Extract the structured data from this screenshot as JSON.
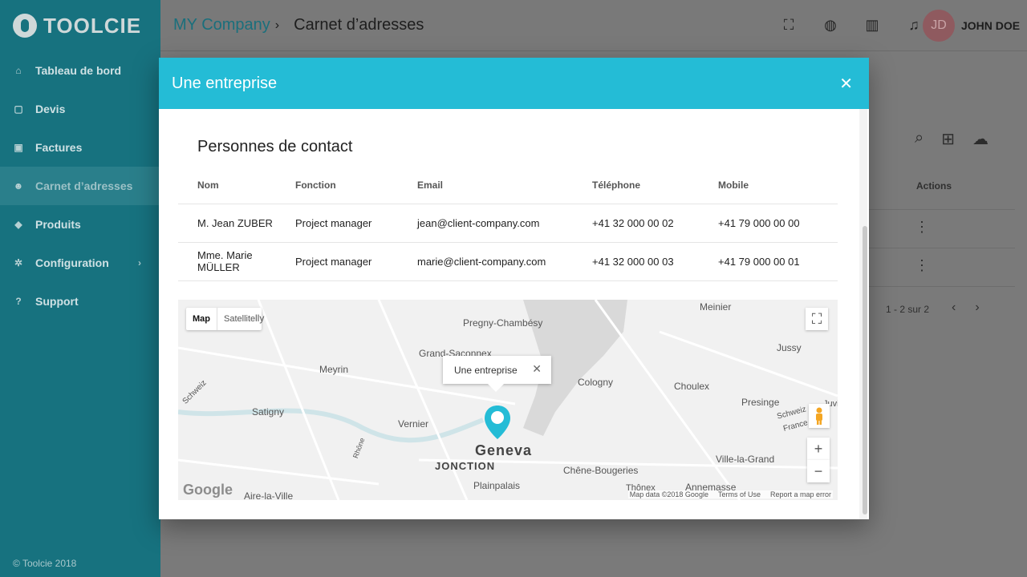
{
  "app": {
    "logo": "TOOLCIE",
    "footer": "© Toolcie 2018"
  },
  "sidebar": {
    "items": [
      {
        "label": "Tableau de bord",
        "icon": "home-icon"
      },
      {
        "label": "Devis",
        "icon": "quote-icon"
      },
      {
        "label": "Factures",
        "icon": "invoice-icon"
      },
      {
        "label": "Carnet d’adresses",
        "icon": "contacts-icon",
        "active": true
      },
      {
        "label": "Produits",
        "icon": "products-icon"
      },
      {
        "label": "Configuration",
        "icon": "gear-icon"
      },
      {
        "label": "Support",
        "icon": "help-icon"
      }
    ]
  },
  "header": {
    "company": "MY Company",
    "separator": "›",
    "page": "Carnet d’adresses",
    "user_initials": "JD",
    "user_name": "JOHN DOE"
  },
  "background": {
    "actions_header": "Actions",
    "pagination": "1 - 2 sur 2"
  },
  "modal": {
    "title": "Une entreprise",
    "section_title": "Personnes de contact",
    "columns": [
      "Nom",
      "Fonction",
      "Email",
      "Téléphone",
      "Mobile"
    ],
    "rows": [
      [
        "M. Jean ZUBER",
        "Project manager",
        "jean@client-company.com",
        "+41 32 000 00 02",
        "+41 79 000 00 00"
      ],
      [
        "Mme. Marie MÜLLER",
        "Project manager",
        "marie@client-company.com",
        "+41 32 000 00 03",
        "+41 79 000 00 01"
      ]
    ]
  },
  "map": {
    "tab_map": "Map",
    "tab_satellite": "Satellite",
    "infowindow": "Une entreprise",
    "labels": {
      "pregny": "Pregny-Chambésy",
      "grand": "Grand-Saconnex",
      "meyrin": "Meyrin",
      "satigny": "Satigny",
      "vernier": "Vernier",
      "geneva": "Geneva",
      "jonction": "JONCTION",
      "plainpalais": "Plainpalais",
      "cologny": "Cologny",
      "choulex": "Choulex",
      "presinge": "Presinge",
      "jussy": "Jussy",
      "meinier": "Meinier",
      "chene": "Chêne-Bougeries",
      "villa": "Ville-la-Grand",
      "annemasse": "Annemasse",
      "aire": "Aire-la-Ville",
      "thonex": "Thônex",
      "schweiz1": "Schweiz",
      "schweiz2": "Schweiz",
      "france": "France",
      "illy": "lly",
      "rhone": "Rhône",
      "juvig": "Juvig"
    },
    "google": "Google",
    "footer": [
      "Map data ©2018 Google",
      "Terms of Use",
      "Report a map error"
    ],
    "accent": "#24bcd6"
  }
}
